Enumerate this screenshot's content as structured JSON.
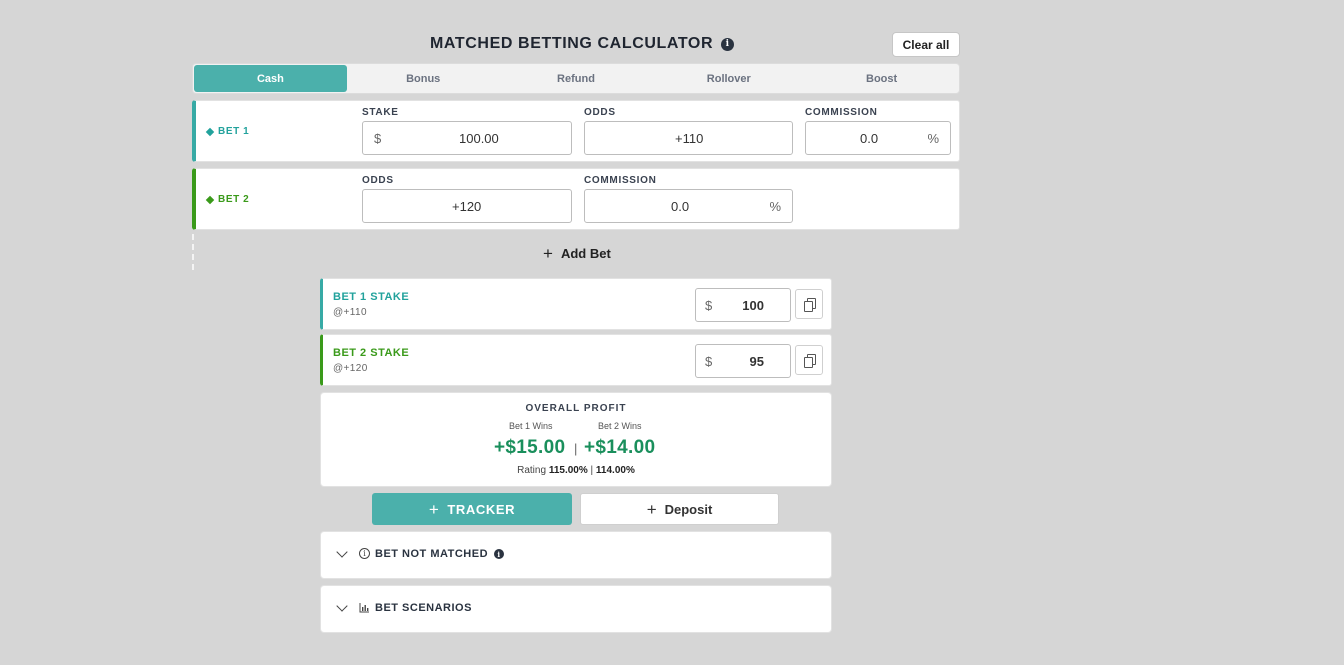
{
  "header": {
    "title": "MATCHED BETTING CALCULATOR",
    "clear_label": "Clear all"
  },
  "tabs": [
    {
      "label": "Cash",
      "active": true
    },
    {
      "label": "Bonus",
      "active": false
    },
    {
      "label": "Refund",
      "active": false
    },
    {
      "label": "Rollover",
      "active": false
    },
    {
      "label": "Boost",
      "active": false
    }
  ],
  "bet1": {
    "label": "BET 1",
    "stake_label": "STAKE",
    "stake_prefix": "$",
    "stake_value": "100.00",
    "odds_label": "ODDS",
    "odds_value": "+110",
    "commission_label": "COMMISSION",
    "commission_value": "0.0",
    "commission_suffix": "%"
  },
  "bet2": {
    "label": "BET 2",
    "odds_label": "ODDS",
    "odds_value": "+120",
    "commission_label": "COMMISSION",
    "commission_value": "0.0",
    "commission_suffix": "%"
  },
  "add_bet_label": "Add Bet",
  "stakes": [
    {
      "title": "BET 1 STAKE",
      "odds": "@+110",
      "prefix": "$",
      "value": "100"
    },
    {
      "title": "BET 2 STAKE",
      "odds": "@+120",
      "prefix": "$",
      "value": "95"
    }
  ],
  "profit": {
    "title": "OVERALL PROFIT",
    "bet1_wins_label": "Bet 1 Wins",
    "bet2_wins_label": "Bet 2 Wins",
    "bet1_value": "+$15.00",
    "bet2_value": "+$14.00",
    "separator": "|",
    "rating_label": "Rating",
    "rating1": "115.00%",
    "rating2": "114.00%"
  },
  "actions": {
    "tracker_label": "TRACKER",
    "deposit_label": "Deposit"
  },
  "accordions": {
    "not_matched": "BET NOT MATCHED",
    "scenarios": "BET SCENARIOS"
  },
  "colors": {
    "accent": "#4bb0ab",
    "bet1": "#22a29c",
    "bet2": "#3a9a1a",
    "profit": "#1a8f5c"
  }
}
